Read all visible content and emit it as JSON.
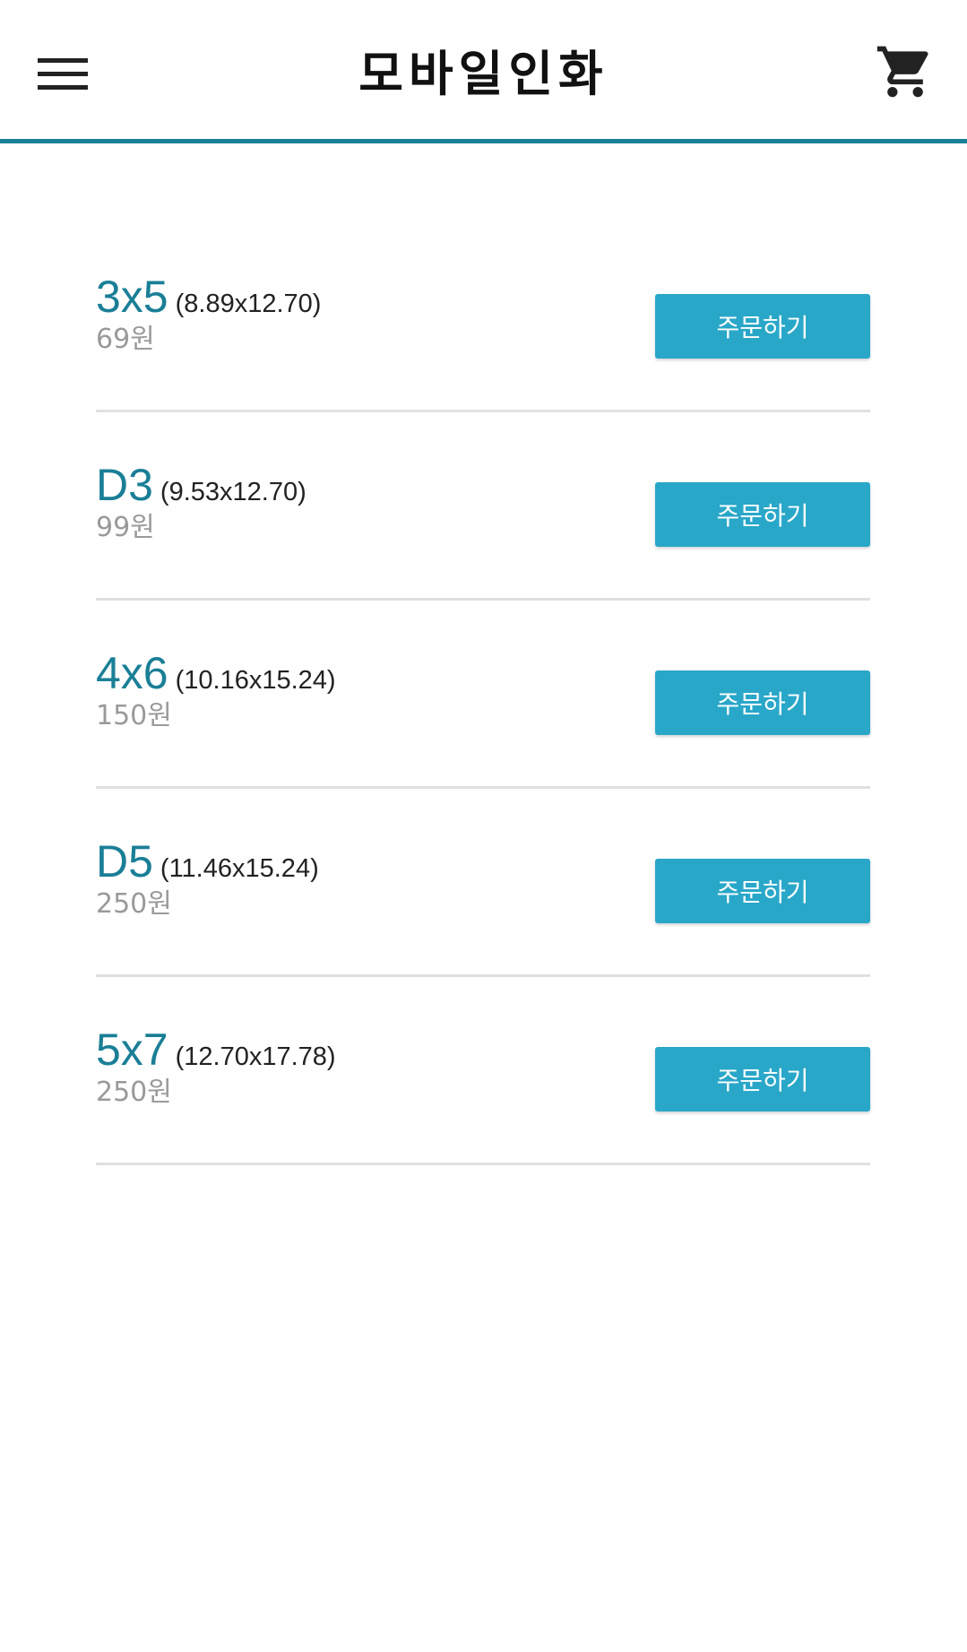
{
  "app_bar": {
    "title": "모바일인화",
    "menu_icon": "hamburger-menu-icon",
    "cart_icon": "shopping-cart-icon",
    "accent_color": "#1a7f96"
  },
  "products": [
    {
      "size": "3x5",
      "dimensions": "(8.89x12.70)",
      "price": "69원",
      "order_label": "주문하기"
    },
    {
      "size": "D3",
      "dimensions": "(9.53x12.70)",
      "price": "99원",
      "order_label": "주문하기"
    },
    {
      "size": "4x6",
      "dimensions": "(10.16x15.24)",
      "price": "150원",
      "order_label": "주문하기"
    },
    {
      "size": "D5",
      "dimensions": "(11.46x15.24)",
      "price": "250원",
      "order_label": "주문하기"
    },
    {
      "size": "5x7",
      "dimensions": "(12.70x17.78)",
      "price": "250원",
      "order_label": "주문하기"
    }
  ],
  "colors": {
    "size_text": "#1a7f96",
    "button_bg": "#29a7c9",
    "price_text": "#9a9a9a",
    "divider": "#e0e0e0"
  }
}
